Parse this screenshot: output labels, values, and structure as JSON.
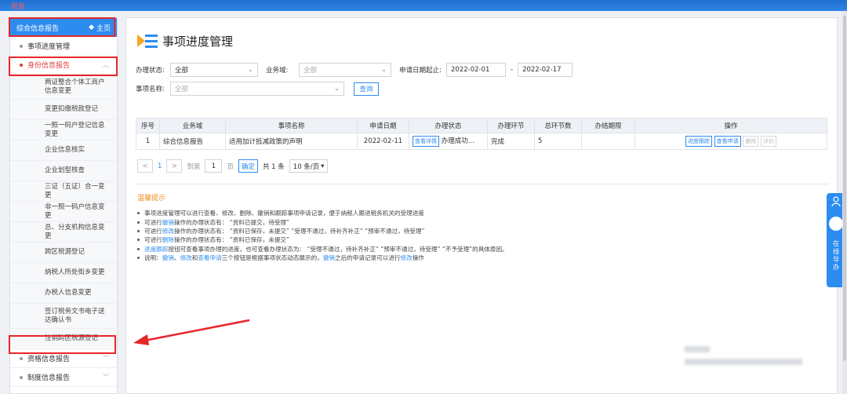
{
  "topbar": {
    "logo_text": "税务"
  },
  "sidebar": {
    "header_title": "综合信息报告",
    "home_label": "主页",
    "items": [
      {
        "label": "事项进度管理"
      },
      {
        "label": "身份信息报告",
        "expanded": true
      }
    ],
    "sub_items": [
      "两证整合个体工商户信息变更",
      "变更扣缴税款登记",
      "一照一码户登记信息变更",
      "企业信息核实",
      "企业划型核查",
      "三证（五证）合一变更",
      "非一照一码户信息变更",
      "总、分支机构信息变更",
      "跨区税源登记",
      "纳税人所处街乡变更",
      "办税人信息变更",
      "签订税务文书电子送达确认书",
      "注销跨区税源登记"
    ],
    "bottom_items": [
      {
        "label": "资格信息报告"
      },
      {
        "label": "制度信息报告"
      }
    ]
  },
  "main": {
    "title": "事项进度管理",
    "filters": {
      "status_label": "办理状态:",
      "status_value": "全部",
      "domain_label": "业务域:",
      "domain_value": "全部",
      "date_label": "申请日期起止:",
      "date_from": "2022-02-01",
      "date_sep": "-",
      "date_to": "2022-02-17",
      "name_label": "事项名称:",
      "name_value": "全部",
      "query_button": "查询"
    },
    "table": {
      "headers": [
        "序号",
        "业务域",
        "事项名称",
        "申请日期",
        "办理状态",
        "办理环节",
        "总环节数",
        "办结期限",
        "操作"
      ],
      "rows": [
        {
          "index": "1",
          "domain": "综合信息报告",
          "name": "适用加计抵减政策的声明",
          "date": "2022-02-11",
          "status_button": "查看详情",
          "status_text": "办理成功...",
          "stage": "完成",
          "total": "5",
          "deadline": "",
          "actions": [
            "进度跟踪",
            "查看申请",
            "删除",
            "评价"
          ]
        }
      ]
    },
    "pager": {
      "prev": "<",
      "page_num": "1",
      "next": ">",
      "goto_label": "到第",
      "goto_value": "1",
      "page_label": "页",
      "ok_button": "确定",
      "total": "共 1 条",
      "page_size": "10 条/页"
    },
    "tips": {
      "title": "温馨提示",
      "lines": [
        [
          {
            "t": "事项进度管理可以进行查看、修改、删除、撤销和跟踪事项申请记录，便于纳税人跟进税务机关的受理进度"
          }
        ],
        [
          {
            "t": "可进行"
          },
          {
            "t": "撤销",
            "hl": true
          },
          {
            "t": "操作的办理状态有：  “资料已提交，待受理”"
          }
        ],
        [
          {
            "t": "可进行"
          },
          {
            "t": "修改",
            "hl": true
          },
          {
            "t": "操作的办理状态有：  “资料已保存，未提交”   “受理不通过，待补齐补正”   “预审不通过，待受理”"
          }
        ],
        [
          {
            "t": "可进行"
          },
          {
            "t": "删除",
            "hl": true
          },
          {
            "t": "操作的办理状态有：  “资料已保存，未提交”"
          }
        ],
        [
          {
            "t": "进度跟踪",
            "hl": true
          },
          {
            "t": "按钮可查看事项办理的进度，也可查看办理状态为：  “受理不通过，待补齐补正”   “预审不通过，待受理”   “不予受理”的具体原因。"
          }
        ],
        [
          {
            "t": "说明："
          },
          {
            "t": "撤销",
            "hl": true
          },
          {
            "t": "、"
          },
          {
            "t": "修改",
            "hl": true
          },
          {
            "t": "和"
          },
          {
            "t": "查看申请",
            "hl": true
          },
          {
            "t": "三个按钮是根据事项状态动态展示的，"
          },
          {
            "t": "撤销",
            "hl": true
          },
          {
            "t": "之后的申请记录可以进行"
          },
          {
            "t": "修改",
            "hl": true
          },
          {
            "t": "操作"
          }
        ]
      ]
    }
  },
  "float_widget": {
    "text": [
      "在",
      "线",
      "导",
      "办"
    ]
  },
  "colors": {
    "accent": "#2d8cf0",
    "highlight": "#e8262a",
    "tips_title": "#f08c1e"
  }
}
